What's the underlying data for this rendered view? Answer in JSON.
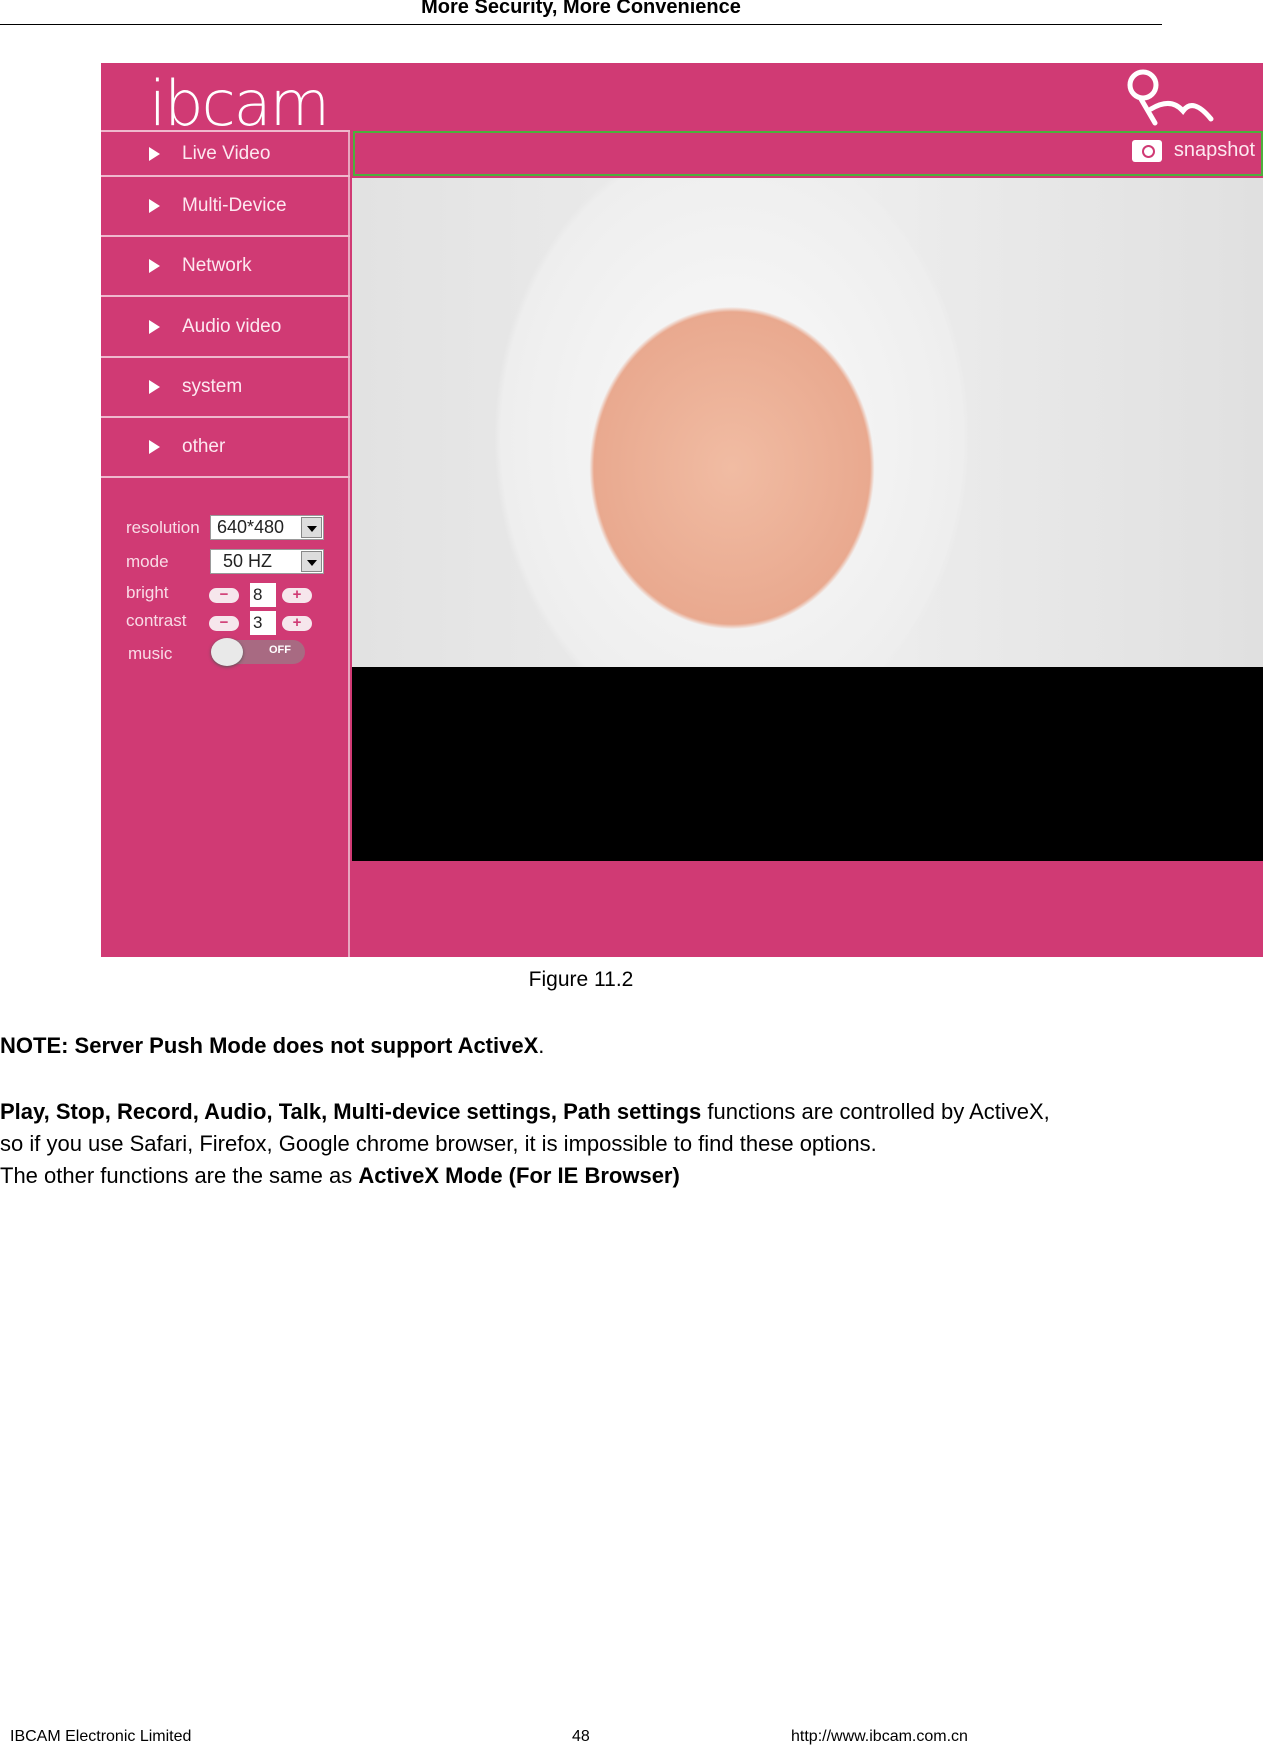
{
  "header": {
    "title": "More Security, More Convenience"
  },
  "app": {
    "logo": "ibcam",
    "menu": [
      {
        "label": "Live Video"
      },
      {
        "label": "Multi-Device"
      },
      {
        "label": "Network"
      },
      {
        "label": "Audio video"
      },
      {
        "label": "system"
      },
      {
        "label": "other"
      }
    ],
    "controls": {
      "resolution": {
        "label": "resolution",
        "value": "640*480"
      },
      "mode": {
        "label": "mode",
        "value": "50 HZ"
      },
      "bright": {
        "label": "bright",
        "value": "8"
      },
      "contrast": {
        "label": "contrast",
        "value": "3"
      },
      "music": {
        "label": "music",
        "state": "OFF"
      }
    },
    "snapshot_label": "snapshot",
    "colors": {
      "brand": "#d03a74",
      "snapshot_border": "#4caf3c"
    }
  },
  "figure_caption": "Figure 11.2",
  "note": {
    "bold": "NOTE: Server Push Mode does not support ActiveX",
    "tail": "."
  },
  "para": {
    "line1_bold": "Play, Stop, Record, Audio, Talk, Multi-device settings, Path settings",
    "line1_rest": " functions are controlled by ActiveX,",
    "line2": "so if you use Safari, Firefox, Google chrome browser, it is impossible to find these options.",
    "line3_start": "The other functions are the same as ",
    "line3_bold": "ActiveX Mode (For IE Browser)"
  },
  "footer": {
    "company": "IBCAM Electronic Limited",
    "page": "48",
    "url": "http://www.ibcam.com.cn"
  }
}
